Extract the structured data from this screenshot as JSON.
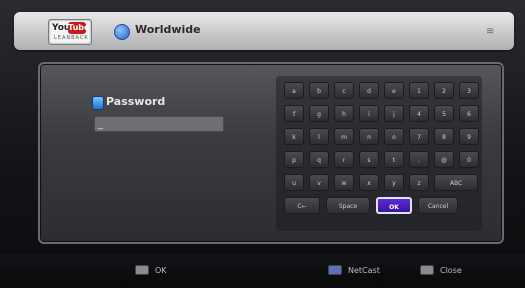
{
  "header": {
    "logo": {
      "you": "You",
      "tube": "Tube",
      "sub": "LEANBACK"
    },
    "region": "Worldwide",
    "globe_icon": "globe-icon",
    "corner_icon": "antenna-icon"
  },
  "password": {
    "label": "Password",
    "value": "_",
    "key_icon": "key-icon"
  },
  "keyboard": {
    "rows": [
      [
        "a",
        "b",
        "c",
        "d",
        "e",
        "1",
        "2",
        "3"
      ],
      [
        "f",
        "g",
        "h",
        "i",
        "j",
        "4",
        "5",
        "6"
      ],
      [
        "k",
        "l",
        "m",
        "n",
        "o",
        "7",
        "8",
        "9"
      ],
      [
        "p",
        "q",
        "r",
        "s",
        "t",
        ".",
        "@",
        "0"
      ],
      [
        "u",
        "v",
        "w",
        "x",
        "y",
        "z",
        "ABC"
      ],
      [
        "C←",
        "Space",
        "OK",
        "Cancel"
      ]
    ]
  },
  "footer": {
    "ok_label": "OK",
    "netcast_label": "NetCast",
    "close_label": "Close"
  }
}
